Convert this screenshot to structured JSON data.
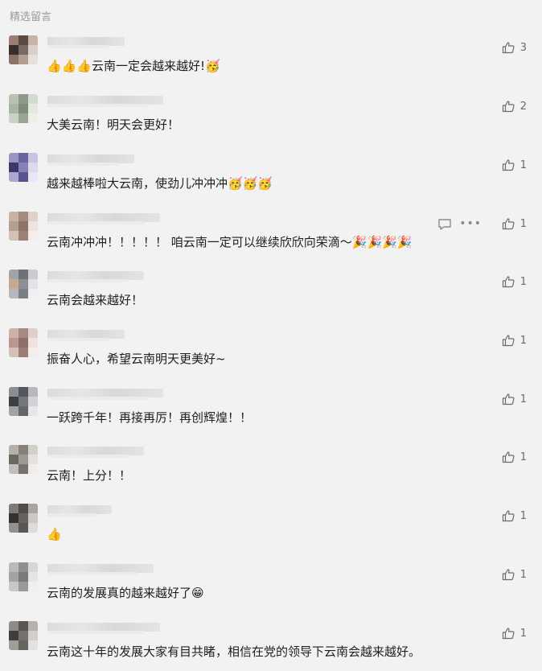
{
  "section": {
    "title": "精选留言"
  },
  "comments": [
    {
      "text": "👍👍👍云南一定会越来越好!🥳",
      "likes": "3"
    },
    {
      "text": "大美云南！明天会更好！",
      "likes": "2"
    },
    {
      "text": "越来越棒啦大云南，使劲儿冲冲冲🥳🥳🥳",
      "likes": "1"
    },
    {
      "text": "云南冲冲冲！！！！！ 咱云南一定可以继续欣欣向荣滴～🎉🎉🎉🎉",
      "likes": "1",
      "show_actions": true
    },
    {
      "text": "云南会越来越好！",
      "likes": "1"
    },
    {
      "text": "振奋人心，希望云南明天更美好~",
      "likes": "1"
    },
    {
      "text": "一跃跨千年！再接再厉！再创辉煌！！",
      "likes": "1"
    },
    {
      "text": "云南！上分！！",
      "likes": "1"
    },
    {
      "text": "👍",
      "likes": "1"
    },
    {
      "text": "云南的发展真的越来越好了😁",
      "likes": "1"
    },
    {
      "text": "云南这十年的发展大家有目共睹，相信在党的领导下云南会越来越好。",
      "likes": "1"
    }
  ],
  "icons": {
    "like": "thumbs-up-icon",
    "reply": "comment-reply-icon",
    "more": "more-dots-icon"
  },
  "colors": {
    "background": "#f2f2f2",
    "text": "#1f1f1f",
    "muted": "#9a9a9a",
    "icon": "#6b6b6b"
  }
}
